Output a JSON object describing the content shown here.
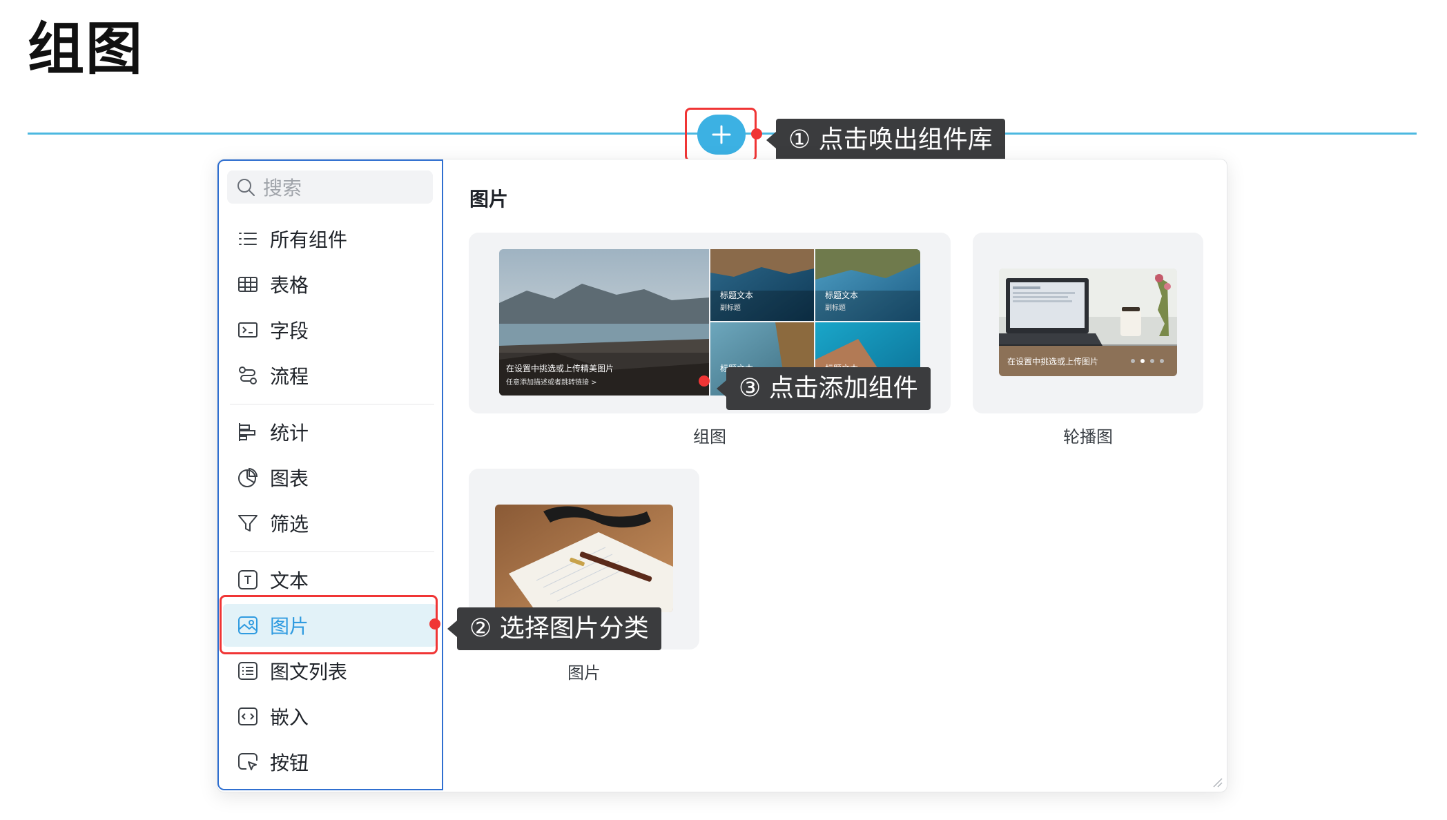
{
  "page": {
    "title": "组图"
  },
  "annotations": {
    "step1": "① 点击唤出组件库",
    "step2": "② 选择图片分类",
    "step3": "③ 点击添加组件"
  },
  "library": {
    "search_placeholder": "搜索",
    "categories": [
      {
        "label": "所有组件",
        "icon": "list-icon"
      },
      {
        "label": "表格",
        "icon": "table-icon"
      },
      {
        "label": "字段",
        "icon": "field-icon"
      },
      {
        "label": "流程",
        "icon": "flow-icon"
      },
      {
        "label": "统计",
        "icon": "statistics-icon"
      },
      {
        "label": "图表",
        "icon": "pie-chart-icon"
      },
      {
        "label": "筛选",
        "icon": "filter-icon"
      },
      {
        "label": "文本",
        "icon": "text-icon"
      },
      {
        "label": "图片",
        "icon": "image-icon",
        "active": true
      },
      {
        "label": "图文列表",
        "icon": "image-text-list-icon"
      },
      {
        "label": "嵌入",
        "icon": "embed-icon"
      },
      {
        "label": "按钮",
        "icon": "button-icon"
      }
    ],
    "section_title": "图片",
    "components": [
      {
        "label": "组图",
        "preview": {
          "main_caption": "在设置中挑选或上传精美图片",
          "main_subcaption": "任意添加描述或者跳转链接 >",
          "tile1_title": "标题文本",
          "tile1_sub": "副标题",
          "tile2_title": "标题文本",
          "tile2_sub": "副标题",
          "tile3_title": "标题文本",
          "tile4_title": "标题文本"
        }
      },
      {
        "label": "轮播图",
        "preview": {
          "caption": "在设置中挑选或上传图片"
        }
      },
      {
        "label": "图片"
      }
    ]
  },
  "colors": {
    "accent": "#3cb1e3",
    "highlight": "#f03535",
    "active_bg": "#e2f2f8",
    "sidebar_border": "#2f6fd0"
  }
}
